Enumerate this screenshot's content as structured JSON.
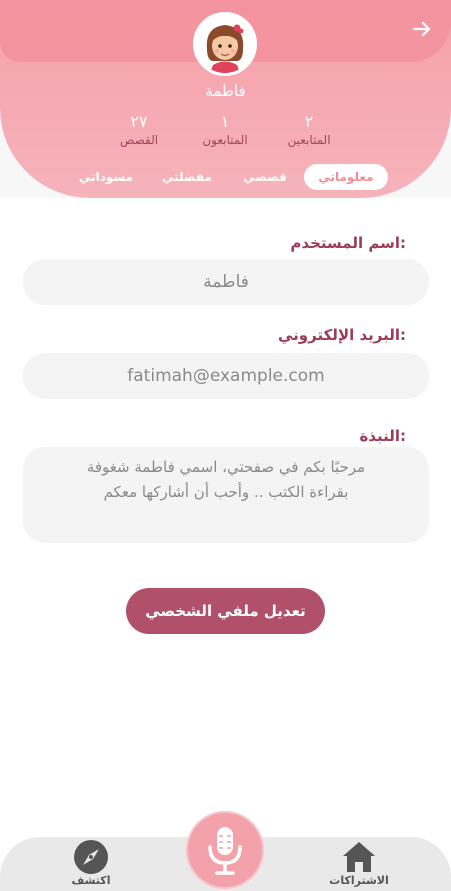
{
  "header": {
    "back_icon": "arrow-right-icon",
    "avatar_icon": "girl-avatar-icon",
    "name": "فاطمة"
  },
  "stats": [
    {
      "num": "٢",
      "label": "المتابعين"
    },
    {
      "num": "١",
      "label": "المتابعون"
    },
    {
      "num": "٢٧",
      "label": "القصص"
    }
  ],
  "tabs": [
    {
      "label": "معلوماتي",
      "active": true
    },
    {
      "label": "قصصي",
      "active": false
    },
    {
      "label": "مفضلتي",
      "active": false
    },
    {
      "label": "مسوداتي",
      "active": false
    }
  ],
  "form": {
    "username_label": "اسم المستخدم:",
    "username_value": "فاطمة",
    "email_label": "البريد الإلكتروني:",
    "email_value": "fatimah@example.com",
    "bio_label": "النبذة:",
    "bio_value": "مرحبًا بكم في صفحتي، اسمي فاطمة شغوفة بقراءة الكتب .. وأحب أن أشاركها معكم"
  },
  "edit_button": "تعديل ملفي الشخصي",
  "bottom_nav": {
    "home_label": "الاشتراكات",
    "home_icon": "home-icon",
    "mic_icon": "microphone-icon",
    "explore_label": "اكتشف",
    "explore_icon": "compass-icon"
  },
  "colors": {
    "header_pink": "#f5a0aa",
    "accent": "#b0506b",
    "label": "#9c3d57"
  }
}
